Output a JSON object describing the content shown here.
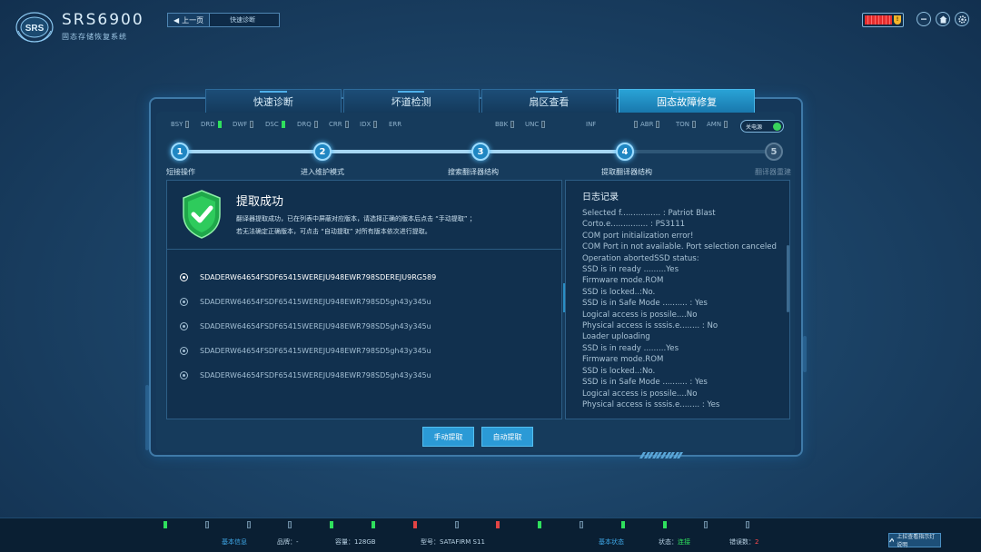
{
  "app": {
    "title": "SRS6900",
    "subtitle": "固态存储恢复系统",
    "logo_text": "SRS"
  },
  "topnav": {
    "back_label": "上一页",
    "breadcrumb": "快速诊断",
    "back_icon": "back-arrow-icon"
  },
  "top_right": {
    "battery_icon": "battery-shield-icon",
    "battery_shield_text": "!",
    "buttons": [
      "minimize-icon",
      "home-icon",
      "settings-icon"
    ]
  },
  "tabs": [
    {
      "label": "快速诊断",
      "active": false
    },
    {
      "label": "坏道检测",
      "active": false
    },
    {
      "label": "扇区查看",
      "active": false
    },
    {
      "label": "固态故障修复",
      "active": true
    }
  ],
  "indicators": [
    {
      "label": "BSY",
      "on": false
    },
    {
      "label": "DRD",
      "on": true
    },
    {
      "label": "DWF",
      "on": false
    },
    {
      "label": "DSC",
      "on": true
    },
    {
      "label": "DRQ",
      "on": false
    },
    {
      "label": "CRR",
      "on": false
    },
    {
      "label": "IDX",
      "on": false
    },
    {
      "label": "ERR",
      "on": false
    },
    {
      "label": "BBK",
      "on": false
    },
    {
      "label": "UNC",
      "on": false
    },
    {
      "label": "INF",
      "on": false
    },
    {
      "label": "ABR",
      "on": false
    },
    {
      "label": "TON",
      "on": false
    },
    {
      "label": "AMN",
      "on": false
    }
  ],
  "power_toggle": {
    "label": "关电源",
    "on": true
  },
  "steps": [
    {
      "num": "1",
      "label": "短接操作",
      "done": true
    },
    {
      "num": "2",
      "label": "进入维护模式",
      "done": true
    },
    {
      "num": "3",
      "label": "搜索翻译器结构",
      "done": true
    },
    {
      "num": "4",
      "label": "提取翻译器结构",
      "done": true
    },
    {
      "num": "5",
      "label": "翻译器重建",
      "done": false
    }
  ],
  "result": {
    "title": "提取成功",
    "desc_line1": "翻译器提取成功，已在列表中屏蔽对应版本，请选择正确的版本后点击 “手动提取” ；",
    "desc_line2": "若无法确定正确版本，可点击 “自动提取” 对所有版本依次进行提取。",
    "icon": "check-shield-icon"
  },
  "versions": [
    {
      "text": "SDADERW64654FSDF65415WEREJU948EWR798SDEREJU9RG589",
      "selected": true
    },
    {
      "text": "SDADERW64654FSDF65415WEREJU948EWR798SD5gh43y345u",
      "selected": false
    },
    {
      "text": "SDADERW64654FSDF65415WEREJU948EWR798SD5gh43y345u",
      "selected": false
    },
    {
      "text": "SDADERW64654FSDF65415WEREJU948EWR798SD5gh43y345u",
      "selected": false
    },
    {
      "text": "SDADERW64654FSDF65415WEREJU948EWR798SD5gh43y345u",
      "selected": false
    }
  ],
  "expander_label": "»",
  "log": {
    "title": "日志记录",
    "lines": [
      "Selected f................ : Patriot Blast",
      "Corto.e............... : PS3111",
      "COM port initialization error!",
      "COM Port in not available. Port selection canceled",
      "Operation abortedSSD status:",
      "SSD is in ready .........Yes",
      "Firmware mode.ROM",
      "SSD is locked..:No.",
      "SSD is in Safe Mode .......... : Yes",
      "Logical access is possile....No",
      "Physical access is sssis.e........ : No",
      "Loader uploading",
      "SSD is in ready .........Yes",
      "Firmware mode.ROM",
      "SSD is locked..:No.",
      "SSD is in Safe Mode .......... : Yes",
      "Logical access is possile....No",
      "Physical access is sssis.e........ : Yes"
    ]
  },
  "buttons": {
    "manual": "手动提取",
    "auto": "自动提取"
  },
  "statusbar": {
    "leds": [
      "green",
      "off",
      "off",
      "off",
      "green",
      "green",
      "red",
      "off",
      "red",
      "green",
      "off",
      "green",
      "green",
      "off",
      "off"
    ],
    "basic_info_title": "基本信息",
    "brand_label": "品牌：-",
    "capacity_label": "容量：128GB",
    "model_label": "型号：SATAFIRM   S11",
    "basic_status_title": "基本状态",
    "state_label": "状态：",
    "state_value": "连接",
    "errors_label": "错误数：",
    "errors_value": "2",
    "help_label": "上拉查看指示灯说明",
    "help_icon": "chevron-up-icon"
  }
}
